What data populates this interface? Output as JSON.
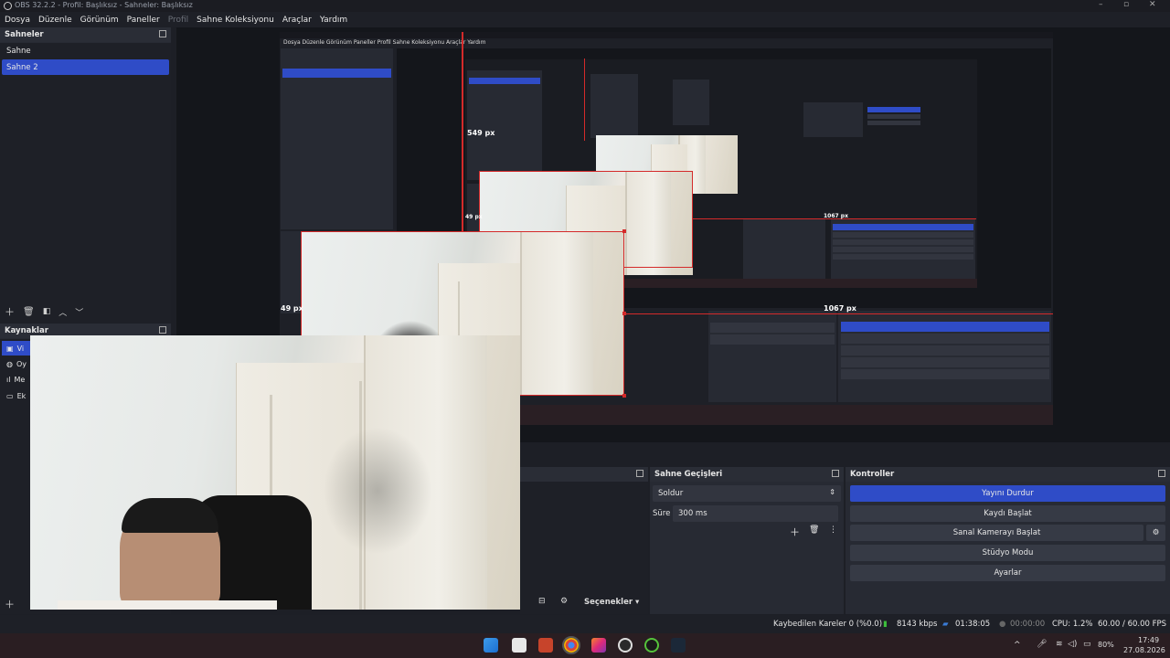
{
  "window": {
    "title": "OBS 32.2.2 - Profil: Başlıksız - Sahneler: Başlıksız"
  },
  "menu": [
    {
      "label": "Dosya",
      "dim": false
    },
    {
      "label": "Düzenle",
      "dim": false
    },
    {
      "label": "Görünüm",
      "dim": false
    },
    {
      "label": "Paneller",
      "dim": false
    },
    {
      "label": "Profil",
      "dim": true
    },
    {
      "label": "Sahne Koleksiyonu",
      "dim": false
    },
    {
      "label": "Araçlar",
      "dim": false
    },
    {
      "label": "Yardım",
      "dim": false
    }
  ],
  "scenes": {
    "title": "Sahneler",
    "items": [
      "Sahne",
      "Sahne 2"
    ],
    "selected_index": 1
  },
  "sources": {
    "title": "Kaynaklar",
    "items": [
      {
        "label": "Vi",
        "icon": "camera-icon"
      },
      {
        "label": "Oy",
        "icon": "gamepad-icon"
      },
      {
        "label": "Me",
        "icon": "audio-icon"
      },
      {
        "label": "Ek",
        "icon": "display-icon"
      }
    ]
  },
  "transitions": {
    "title": "Sahne Geçişleri",
    "selected": "Soldur",
    "duration_label": "Süre",
    "duration_value": "300 ms"
  },
  "controls": {
    "title": "Kontroller",
    "buttons": [
      "Yayını Durdur",
      "Kaydı Başlat",
      "Sanal Kamerayı Başlat",
      "Stüdyo Modu",
      "Ayarlar"
    ]
  },
  "mixer": {
    "options_label": "Seçenekler"
  },
  "preview_labels": {
    "size_a": "549 px",
    "size_b": "1067 px",
    "size_c": "49 px",
    "size_d": "1067 px",
    "size_e": "49 px"
  },
  "status": {
    "dropped_frames": "Kaybedilen Kareler 0 (%0.0)",
    "bitrate": "8143 kbps",
    "stream_time": "01:38:05",
    "record_time": "00:00:00",
    "cpu": "CPU: 1.2%",
    "fps": "60.00 / 60.00 FPS"
  },
  "taskbar": {
    "battery": "80%",
    "time": "17:49",
    "date": "27.08.2026"
  },
  "colors": {
    "accent": "#2f4cc7",
    "recording_red": "#d42a2a",
    "panel_bg": "#1e2027",
    "dock_bg": "#272a33"
  }
}
